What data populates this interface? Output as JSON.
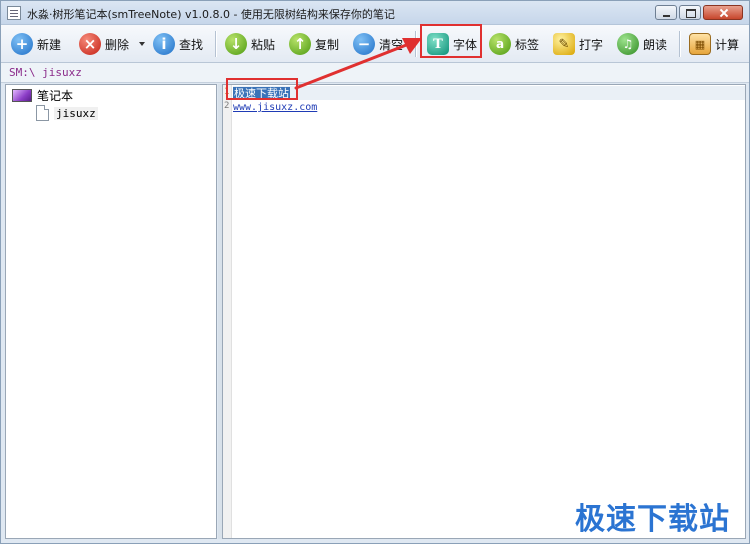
{
  "window": {
    "title": "水淼·树形笔记本(smTreeNote) v1.0.8.0 - 使用无限树结构来保存你的笔记"
  },
  "toolbar": {
    "new_label": "新建",
    "delete_label": "删除",
    "find_label": "查找",
    "paste_label": "粘贴",
    "copy_label": "复制",
    "clear_label": "清空",
    "font_label": "字体",
    "tag_label": "标签",
    "type_label": "打字",
    "read_label": "朗读",
    "calc_label": "计算",
    "icons": {
      "new": "plus-icon",
      "delete": "x-icon",
      "find": "info-icon",
      "paste": "down-arrow-icon",
      "copy": "up-arrow-icon",
      "clear": "minus-icon",
      "font": "font-icon",
      "tag": "tag-icon",
      "type": "pencil-icon",
      "read": "headphones-icon",
      "calc": "calculator-icon"
    }
  },
  "path": {
    "text": "SM:\\ jisuxz"
  },
  "tree": {
    "root_label": "笔记本",
    "children": [
      {
        "label": "jisuxz"
      }
    ]
  },
  "editor": {
    "lines": [
      {
        "no": "1",
        "text": "极速下载站"
      },
      {
        "no": "2",
        "text": "www.jisuxz.com"
      }
    ]
  },
  "watermark": {
    "text": "极速下载站"
  },
  "colors": {
    "highlight": "#e03030",
    "selection": "#3a73b8",
    "watermark": "#2b74d2"
  }
}
